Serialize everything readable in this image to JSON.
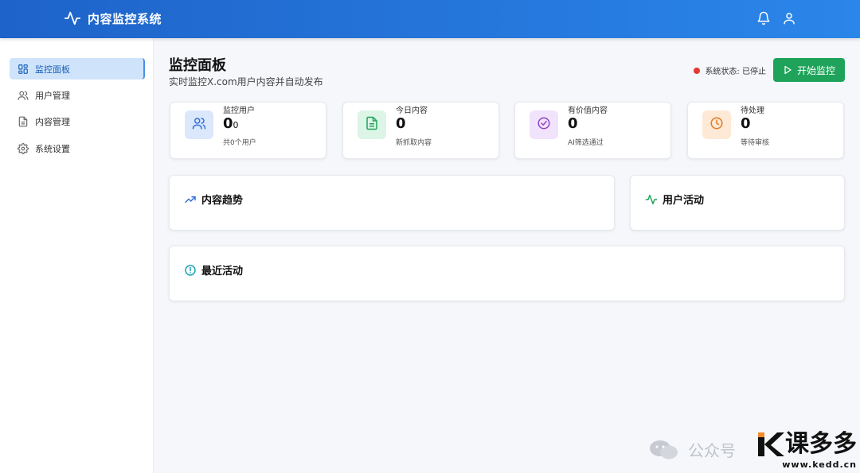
{
  "app": {
    "title": "内容监控系统"
  },
  "header": {
    "icons": [
      "bell-icon",
      "user-icon"
    ]
  },
  "sidebar": {
    "items": [
      {
        "label": "监控面板",
        "icon": "dashboard-icon",
        "active": true
      },
      {
        "label": "用户管理",
        "icon": "users-icon",
        "active": false
      },
      {
        "label": "内容管理",
        "icon": "file-icon",
        "active": false
      },
      {
        "label": "系统设置",
        "icon": "gear-icon",
        "active": false
      }
    ]
  },
  "page": {
    "title": "监控面板",
    "subtitle": "实时监控X.com用户内容并自动发布",
    "status_label": "系统状态: 已停止",
    "status_color": "#e53935",
    "start_button": "开始监控"
  },
  "stats": [
    {
      "label": "监控用户",
      "value": "0",
      "value_suffix": "0",
      "sub": "共0个用户",
      "icon": "users-icon",
      "color": "#2f6fd6",
      "bg": "#dbe8fb"
    },
    {
      "label": "今日内容",
      "value": "0",
      "value_suffix": "",
      "sub": "新抓取内容",
      "icon": "file-icon",
      "color": "#1fa35a",
      "bg": "#dcf5e6"
    },
    {
      "label": "有价值内容",
      "value": "0",
      "value_suffix": "",
      "sub": "AI筛选通过",
      "icon": "check-circle-icon",
      "color": "#8e44c9",
      "bg": "#f1e3fb"
    },
    {
      "label": "待处理",
      "value": "0",
      "value_suffix": "",
      "sub": "等待审核",
      "icon": "clock-icon",
      "color": "#e07b22",
      "bg": "#fde9d6"
    }
  ],
  "panels": {
    "trend": {
      "title": "内容趋势",
      "icon": "trending-up-icon"
    },
    "activity": {
      "title": "用户活动",
      "icon": "activity-icon"
    },
    "recent": {
      "title": "最近活动",
      "icon": "info-icon"
    }
  },
  "watermark": {
    "text": "公众号",
    "brand": "课多多",
    "url": "www.kedd.cn"
  }
}
